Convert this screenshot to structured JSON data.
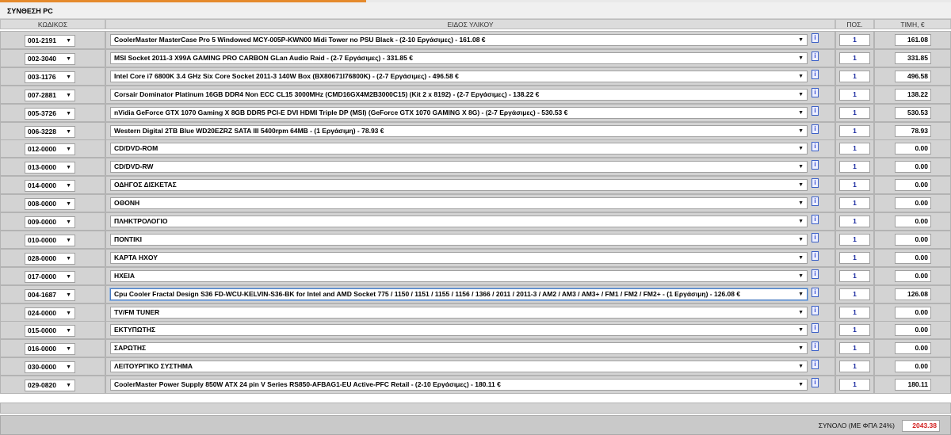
{
  "title": "ΣΥΝΘΕΣΗ PC",
  "columns": {
    "code": "ΚΩΔΙΚΟΣ",
    "item": "ΕΙΔΟΣ ΥΛΙΚΟΥ",
    "qty": "ΠΟΣ.",
    "price": "ΤΙΜΗ, €"
  },
  "info_label": "i",
  "rows": [
    {
      "code": "001-2191",
      "item": "CoolerMaster MasterCase Pro 5 Windowed MCY-005P-KWN00 Midi Tower no PSU Black - (2-10 Εργάσιμες) - 161.08 €",
      "qty": "1",
      "price": "161.08"
    },
    {
      "code": "002-3040",
      "item": "MSI Socket 2011-3 X99A GAMING PRO CARBON GLan Audio Raid - (2-7 Εργάσιμες) - 331.85 €",
      "qty": "1",
      "price": "331.85"
    },
    {
      "code": "003-1176",
      "item": "Intel Core i7 6800K 3.4 GHz Six Core Socket 2011-3 140W Box (BX80671I76800K) - (2-7 Εργάσιμες) - 496.58 €",
      "qty": "1",
      "price": "496.58"
    },
    {
      "code": "007-2881",
      "item": "Corsair Dominator Platinum 16GB DDR4 Non ECC CL15 3000MHz (CMD16GX4M2B3000C15) (Kit 2 x 8192) - (2-7 Εργάσιμες) - 138.22 €",
      "qty": "1",
      "price": "138.22"
    },
    {
      "code": "005-3726",
      "item": "nVidia GeForce GTX 1070 Gaming X 8GB DDR5 PCI-E DVI HDMI Triple DP (MSI) (GeForce GTX 1070 GAMING X 8G) - (2-7 Εργάσιμες) - 530.53 €",
      "qty": "1",
      "price": "530.53"
    },
    {
      "code": "006-3228",
      "item": "Western Digital 2TB Blue WD20EZRZ SATA III 5400rpm 64MB - (1 Εργάσιμη) - 78.93 €",
      "qty": "1",
      "price": "78.93"
    },
    {
      "code": "012-0000",
      "item": "CD/DVD-ROM",
      "qty": "1",
      "price": "0.00"
    },
    {
      "code": "013-0000",
      "item": "CD/DVD-RW",
      "qty": "1",
      "price": "0.00"
    },
    {
      "code": "014-0000",
      "item": "ΟΔΗΓΟΣ ΔΙΣΚΕΤΑΣ",
      "qty": "1",
      "price": "0.00"
    },
    {
      "code": "008-0000",
      "item": "ΟΘΟΝΗ",
      "qty": "1",
      "price": "0.00"
    },
    {
      "code": "009-0000",
      "item": "ΠΛΗΚΤΡΟΛΟΓΙΟ",
      "qty": "1",
      "price": "0.00"
    },
    {
      "code": "010-0000",
      "item": "ΠΟΝΤΙΚΙ",
      "qty": "1",
      "price": "0.00"
    },
    {
      "code": "028-0000",
      "item": "ΚΑΡΤΑ ΗΧΟΥ",
      "qty": "1",
      "price": "0.00"
    },
    {
      "code": "017-0000",
      "item": "ΗΧΕΙΑ",
      "qty": "1",
      "price": "0.00"
    },
    {
      "code": "004-1687",
      "item": "Cpu Cooler Fractal Design S36 FD-WCU-KELVIN-S36-BK for Intel and AMD Socket 775 / 1150 / 1151 / 1155 / 1156 / 1366 / 2011 / 2011-3 / AM2 / AM3 / AM3+ / FM1 / FM2 / FM2+ - (1 Εργάσιμη) - 126.08 €",
      "qty": "1",
      "price": "126.08",
      "focused": true
    },
    {
      "code": "024-0000",
      "item": "TV/FM TUNER",
      "qty": "1",
      "price": "0.00"
    },
    {
      "code": "015-0000",
      "item": "ΕΚΤΥΠΩΤΗΣ",
      "qty": "1",
      "price": "0.00"
    },
    {
      "code": "016-0000",
      "item": "ΣΑΡΩΤΗΣ",
      "qty": "1",
      "price": "0.00"
    },
    {
      "code": "030-0000",
      "item": "ΛΕΙΤΟΥΡΓΙΚΟ ΣΥΣΤΗΜΑ",
      "qty": "1",
      "price": "0.00"
    },
    {
      "code": "029-0820",
      "item": "CoolerMaster Power Supply 850W ATX 24 pin V Series RS850-AFBAG1-EU Active-PFC Retail - (2-10 Εργάσιμες) - 180.11 €",
      "qty": "1",
      "price": "180.11"
    }
  ],
  "total": {
    "label": "ΣΥΝΟΛΟ (ΜΕ ΦΠΑ 24%)",
    "value": "2043.38"
  }
}
